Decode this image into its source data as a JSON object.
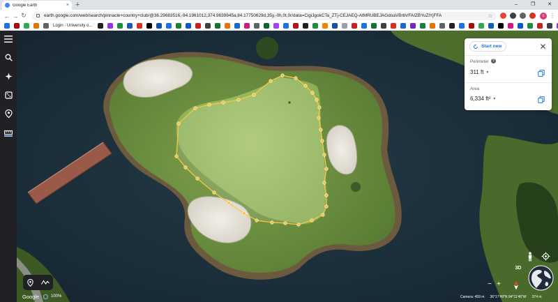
{
  "browser": {
    "tab_title": "Google Earth",
    "tab_close": "×",
    "new_tab": "+",
    "window_controls": [
      "–",
      "❐",
      "✕"
    ],
    "url": "earth.google.com/web/search/pinnacle+country+club/@36.29683516,-94.1961012,374.9639945a,84.17750629d,35y,-0h,0t,0r/data=CigiJgokCTa_ZTj-CEJAEQ-AtMRUBEJAGdoaVBrbVFAIZBYuZlYjFFA",
    "bookmark_login_label": "Login - University o...",
    "extension_colors": [
      "#ea4335",
      "#3c4043",
      "#5f6368",
      "#d93025"
    ],
    "profile_initial": "c",
    "bookmark_colors": [
      "#1a73e8",
      "#a50e0e",
      "#34a853",
      "#e37400",
      "#5f6368",
      "#202124",
      "#9334e6",
      "#1e8e3e",
      "#185abc",
      "#d93025",
      "#000000",
      "#174ea6",
      "#1a73e8",
      "#188038",
      "#0b57d0",
      "#c5221f",
      "#3c4043",
      "#137333",
      "#e8710a",
      "#1967d2",
      "#d01884",
      "#5f6368",
      "#0d652d",
      "#a142f4",
      "#1a73e8",
      "#b31412",
      "#202124",
      "#1e8e3e",
      "#ea8600",
      "#174ea6",
      "#9aa0a6",
      "#c5221f",
      "#1a73e8",
      "#137333",
      "#3c4043",
      "#d93025",
      "#1967d2",
      "#7627bb",
      "#188038",
      "#e37400",
      "#5f6368",
      "#202124",
      "#1a73e8",
      "#a50e0e",
      "#34a853",
      "#185abc",
      "#000000",
      "#d01884",
      "#0b57d0",
      "#1e8e3e",
      "#c5221f",
      "#3c4043",
      "#9334e6",
      "#1a73e8",
      "#e8710a",
      "#137333",
      "#202124",
      "#d93025",
      "#1967d2",
      "#5f6368",
      "#188038",
      "#174ea6",
      "#a142f4",
      "#1a73e8"
    ]
  },
  "sidebar": {
    "items": [
      {
        "name": "menu-icon"
      },
      {
        "name": "search-icon"
      },
      {
        "name": "voyager-icon"
      },
      {
        "name": "feeling-lucky-icon"
      },
      {
        "name": "projects-icon"
      },
      {
        "name": "ruler-icon",
        "active": true
      }
    ]
  },
  "measure_panel": {
    "start_new_label": "Start new",
    "perimeter_label": "Perimeter",
    "perimeter_value": "311 ft",
    "area_label": "Area",
    "area_value": "6,334 ft²",
    "help_glyph": "?"
  },
  "map": {
    "polygon_color": "#f6c842",
    "logo": "Google",
    "zoom_percent": "100%"
  },
  "map_controls": {
    "three_d_label": "3D",
    "zoom_out_label": "−",
    "zoom_in_label": "+"
  },
  "status": {
    "camera": "Camera: 459 m",
    "coordinates": "36°17'49\"N 94°11'46\"W",
    "altitude": "374 m"
  }
}
